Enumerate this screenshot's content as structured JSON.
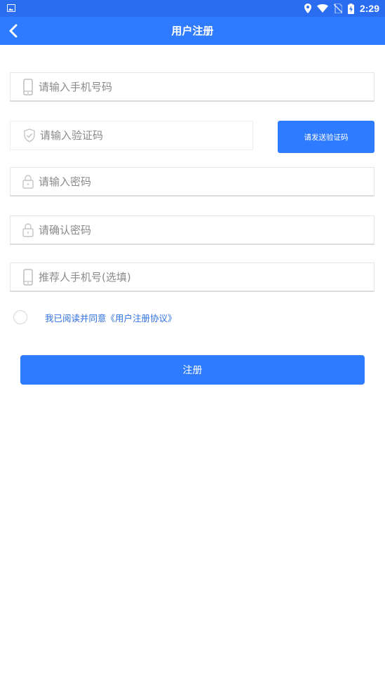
{
  "status_bar": {
    "time": "2:29",
    "icons": [
      "image-icon",
      "location-icon",
      "wifi-icon",
      "no-sim-icon",
      "battery-charging-icon"
    ]
  },
  "app_bar": {
    "title": "用户注册",
    "back_icon": "back-arrow-icon"
  },
  "form": {
    "phone_placeholder": "请输入手机号码",
    "code_placeholder": "请输入验证码",
    "send_code_label": "请发送验证码",
    "password_placeholder": "请输入密码",
    "confirm_password_placeholder": "请确认密码",
    "referrer_placeholder": "推荐人手机号(选填)",
    "agreement_text": "我已阅读并同意《用户注册协议》",
    "submit_label": "注册"
  },
  "colors": {
    "status_bar": "#2a6df0",
    "primary": "#2f7bff",
    "link": "#2f6fe0",
    "placeholder": "#8a8a8a"
  }
}
